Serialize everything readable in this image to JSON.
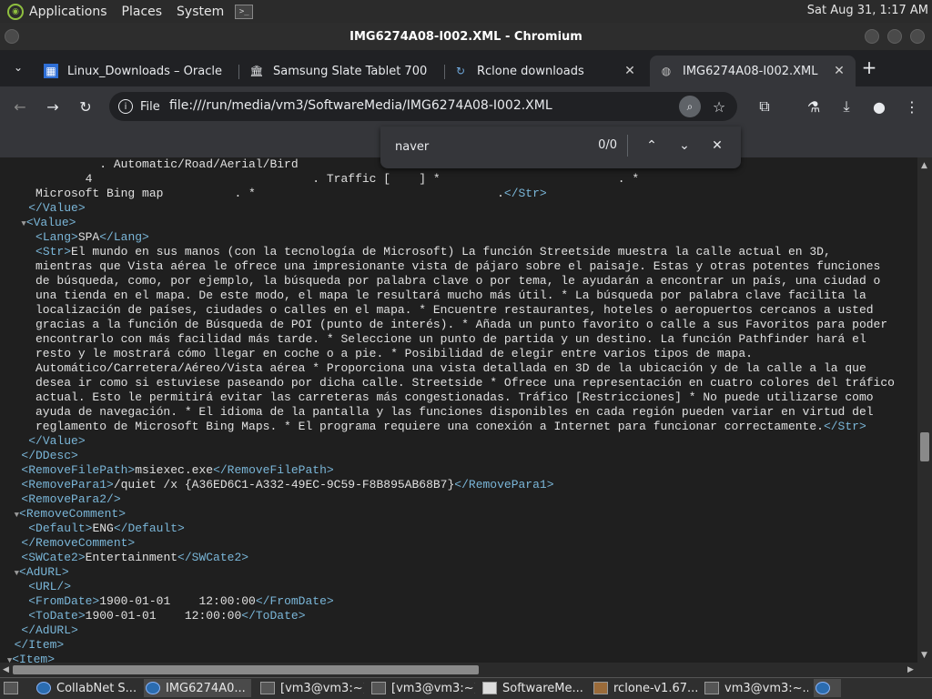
{
  "top_panel": {
    "menus": [
      "Applications",
      "Places",
      "System"
    ],
    "clock": "Sat Aug 31,  1:17 AM"
  },
  "window": {
    "title": "IMG6274A08-I002.XML - Chromium"
  },
  "tabs": [
    {
      "title": "Linux_Downloads – Oracle",
      "icon": "oracle-favicon"
    },
    {
      "title": "Samsung Slate Tablet 700",
      "icon": "bank-favicon"
    },
    {
      "title": "Rclone downloads",
      "icon": "rclone-favicon"
    },
    {
      "title": "IMG6274A08-I002.XML",
      "icon": "globe-favicon",
      "active": true
    }
  ],
  "toolbar": {
    "file_label": "File",
    "url": "file:///run/media/vm3/SoftwareMedia/IMG6274A08-I002.XML"
  },
  "find_bar": {
    "query": "naver",
    "count": "0/0"
  },
  "xml_lines": [
    {
      "indent": 0,
      "html": "              . Automatic/Road/Aerial/Bird                                            . Streetside *"
    },
    {
      "indent": 0,
      "html": "            4                               . Traffic [    ] *                         . *"
    },
    {
      "indent": 0,
      "html": "     Microsoft Bing map          . *                                  .<span class=\"tag\">&lt;/Str&gt;</span>"
    },
    {
      "indent": 0,
      "html": "    <span class=\"tag\">&lt;/Value&gt;</span>"
    },
    {
      "indent": 0,
      "html": "   <span class=\"arrow\">▼</span><span class=\"tag\">&lt;Value&gt;</span>"
    },
    {
      "indent": 0,
      "html": "     <span class=\"tag\">&lt;Lang&gt;</span>SPA<span class=\"tag\">&lt;/Lang&gt;</span>"
    },
    {
      "indent": 0,
      "html": "     <span class=\"tag\">&lt;Str&gt;</span>El mundo en sus manos (con la tecnología de Microsoft) La función Streetside muestra la calle actual en 3D,"
    },
    {
      "indent": 0,
      "html": "     mientras que Vista aérea le ofrece una impresionante vista de pájaro sobre el paisaje. Estas y otras potentes funciones"
    },
    {
      "indent": 0,
      "html": "     de búsqueda, como, por ejemplo, la búsqueda por palabra clave o por tema, le ayudarán a encontrar un país, una ciudad o"
    },
    {
      "indent": 0,
      "html": "     una tienda en el mapa. De este modo, el mapa le resultará mucho más útil. * La búsqueda por palabra clave facilita la"
    },
    {
      "indent": 0,
      "html": "     localización de países, ciudades o calles en el mapa. * Encuentre restaurantes, hoteles o aeropuertos cercanos a usted"
    },
    {
      "indent": 0,
      "html": "     gracias a la función de Búsqueda de POI (punto de interés). * Añada un punto favorito o calle a sus Favoritos para poder"
    },
    {
      "indent": 0,
      "html": "     encontrarlo con más facilidad más tarde. * Seleccione un punto de partida y un destino. La función Pathfinder hará el"
    },
    {
      "indent": 0,
      "html": "     resto y le mostrará cómo llegar en coche o a pie. * Posibilidad de elegir entre varios tipos de mapa."
    },
    {
      "indent": 0,
      "html": "     Automático/Carretera/Aéreo/Vista aérea * Proporciona una vista detallada en 3D de la ubicación y de la calle a la que"
    },
    {
      "indent": 0,
      "html": "     desea ir como si estuviese paseando por dicha calle. Streetside * Ofrece una representación en cuatro colores del tráfico"
    },
    {
      "indent": 0,
      "html": "     actual. Esto le permitirá evitar las carreteras más congestionadas. Tráfico [Restricciones] * No puede utilizarse como"
    },
    {
      "indent": 0,
      "html": "     ayuda de navegación. * El idioma de la pantalla y las funciones disponibles en cada región pueden variar en virtud del"
    },
    {
      "indent": 0,
      "html": "     reglamento de Microsoft Bing Maps. * El programa requiere una conexión a Internet para funcionar correctamente.<span class=\"tag\">&lt;/Str&gt;</span>"
    },
    {
      "indent": 0,
      "html": "    <span class=\"tag\">&lt;/Value&gt;</span>"
    },
    {
      "indent": 0,
      "html": "   <span class=\"tag\">&lt;/DDesc&gt;</span>"
    },
    {
      "indent": 0,
      "html": "   <span class=\"tag\">&lt;RemoveFilePath&gt;</span>msiexec.exe<span class=\"tag\">&lt;/RemoveFilePath&gt;</span>"
    },
    {
      "indent": 0,
      "html": "   <span class=\"tag\">&lt;RemovePara1&gt;</span>/quiet /x {A36ED6C1-A332-49EC-9C59-F8B895AB68B7}<span class=\"tag\">&lt;/RemovePara1&gt;</span>"
    },
    {
      "indent": 0,
      "html": "   <span class=\"tag\">&lt;RemovePara2/&gt;</span>"
    },
    {
      "indent": 0,
      "html": "  <span class=\"arrow\">▼</span><span class=\"tag\">&lt;RemoveComment&gt;</span>"
    },
    {
      "indent": 0,
      "html": "    <span class=\"tag\">&lt;Default&gt;</span>ENG<span class=\"tag\">&lt;/Default&gt;</span>"
    },
    {
      "indent": 0,
      "html": "   <span class=\"tag\">&lt;/RemoveComment&gt;</span>"
    },
    {
      "indent": 0,
      "html": "   <span class=\"tag\">&lt;SWCate2&gt;</span>Entertainment<span class=\"tag\">&lt;/SWCate2&gt;</span>"
    },
    {
      "indent": 0,
      "html": "  <span class=\"arrow\">▼</span><span class=\"tag\">&lt;AdURL&gt;</span>"
    },
    {
      "indent": 0,
      "html": "    <span class=\"tag\">&lt;URL/&gt;</span>"
    },
    {
      "indent": 0,
      "html": "    <span class=\"tag\">&lt;FromDate&gt;</span>1900-01-01    12:00:00<span class=\"tag\">&lt;/FromDate&gt;</span>"
    },
    {
      "indent": 0,
      "html": "    <span class=\"tag\">&lt;ToDate&gt;</span>1900-01-01    12:00:00<span class=\"tag\">&lt;/ToDate&gt;</span>"
    },
    {
      "indent": 0,
      "html": "   <span class=\"tag\">&lt;/AdURL&gt;</span>"
    },
    {
      "indent": 0,
      "html": "  <span class=\"tag\">&lt;/Item&gt;</span>"
    },
    {
      "indent": 0,
      "html": " <span class=\"arrow\">▼</span><span class=\"tag\">&lt;Item&gt;</span>"
    }
  ],
  "taskbar": [
    {
      "label": "CollabNet S...",
      "icon": "chrome"
    },
    {
      "label": "IMG6274A0...",
      "icon": "chrome",
      "active": true
    },
    {
      "label": "[vm3@vm3:~]",
      "icon": "terminal"
    },
    {
      "label": "[vm3@vm3:~]",
      "icon": "terminal"
    },
    {
      "label": "SoftwareMe...",
      "icon": "folder"
    },
    {
      "label": "rclone-v1.67....",
      "icon": "package"
    },
    {
      "label": "vm3@vm3:~...",
      "icon": "terminal"
    }
  ]
}
